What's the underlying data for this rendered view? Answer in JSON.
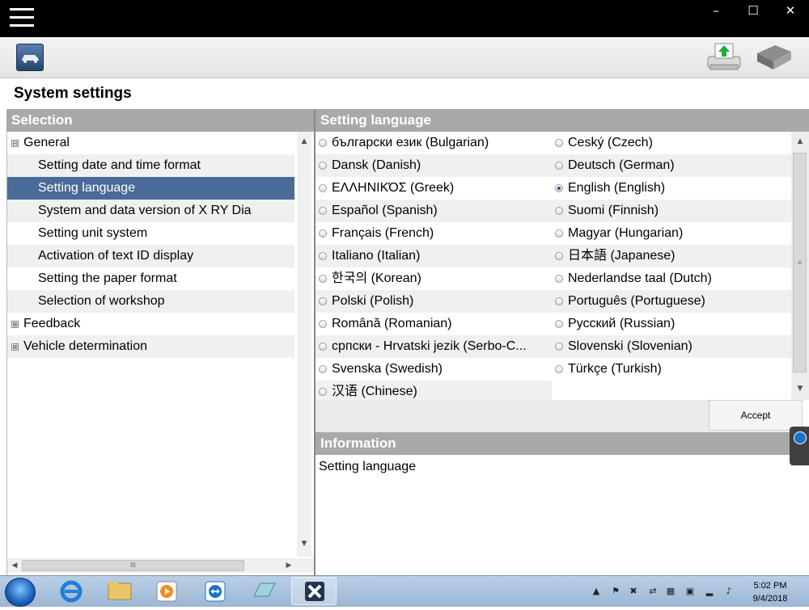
{
  "window": {
    "menu_icon": "hamburger-icon",
    "minimize": "–",
    "maximize": "☐",
    "close": "✕"
  },
  "toolbar": {
    "vehicle_icon": "car-icon",
    "upload_icon": "printer-upload-icon",
    "manual_icon": "book-icon"
  },
  "page_title": "System settings",
  "selection": {
    "header": "Selection",
    "items": [
      {
        "label": "General",
        "level": 0,
        "expander": "⊟"
      },
      {
        "label": "Setting date and time format",
        "level": 1
      },
      {
        "label": "Setting language",
        "level": 1,
        "selected": true
      },
      {
        "label": "System and data version of X  RY Dia",
        "level": 1
      },
      {
        "label": "Setting unit system",
        "level": 1
      },
      {
        "label": "Activation of text ID display",
        "level": 1
      },
      {
        "label": "Setting the paper format",
        "level": 1
      },
      {
        "label": "Selection of workshop",
        "level": 1
      },
      {
        "label": "Feedback",
        "level": 0,
        "expander": "⊞"
      },
      {
        "label": "Vehicle determination",
        "level": 0,
        "expander": "⊞"
      }
    ],
    "hscroll_thumb": "III"
  },
  "language": {
    "header": "Setting language",
    "left_column": [
      "български език (Bulgarian)",
      "Dansk (Danish)",
      "ΕΛΛΗΝΙΚΌΣ (Greek)",
      "Español (Spanish)",
      "Français (French)",
      "Italiano (Italian)",
      "한국의 (Korean)",
      "Polski (Polish)",
      "Română (Romanian)",
      "српски - Hrvatski jezik (Serbo-C...",
      "Svenska (Swedish)",
      "汉语 (Chinese)"
    ],
    "right_column": [
      "Ceský (Czech)",
      "Deutsch (German)",
      "English (English)",
      "Suomi (Finnish)",
      "Magyar (Hungarian)",
      "日本語 (Japanese)",
      "Nederlandse taal (Dutch)",
      "Português (Portuguese)",
      "Русский (Russian)",
      "Slovenski (Slovenian)",
      "Türkçe (Turkish)"
    ],
    "selected": "English (English)",
    "accept_label": "Accept"
  },
  "information": {
    "header": "Information",
    "text": "Setting language"
  },
  "taskbar": {
    "clock_time": "5:02 PM",
    "clock_date": "9/4/2018",
    "tray_expand": "▲"
  },
  "colors": {
    "selection_bg": "#4a6a98",
    "panel_header_bg": "#a9a9a9",
    "titlebar_bg": "#000000"
  }
}
